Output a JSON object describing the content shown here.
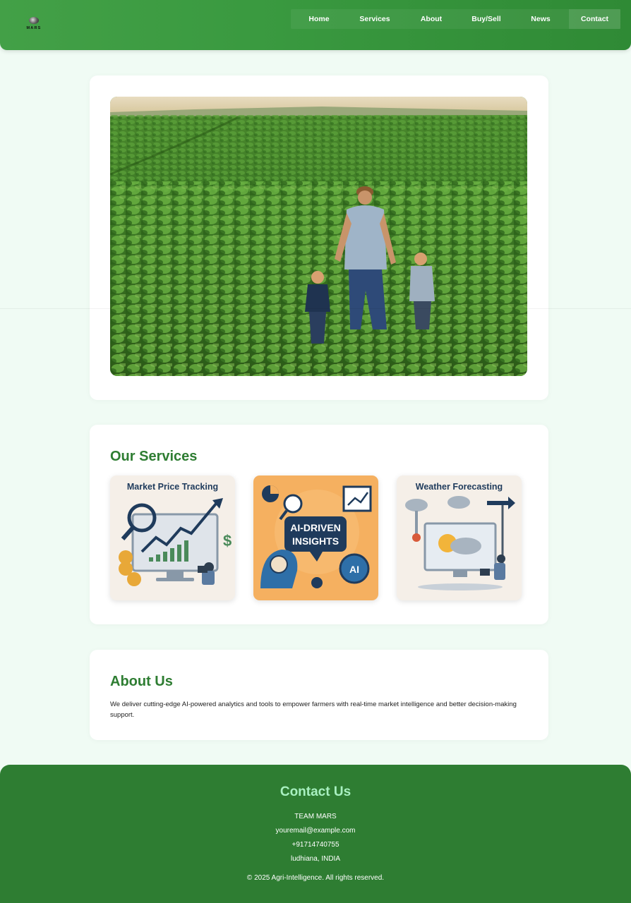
{
  "brand": {
    "logo_text": "MARS"
  },
  "nav": {
    "items": [
      {
        "label": "Home"
      },
      {
        "label": "Services"
      },
      {
        "label": "About"
      },
      {
        "label": "Buy/Sell"
      },
      {
        "label": "News"
      },
      {
        "label": "Contact"
      }
    ]
  },
  "services": {
    "title": "Our Services",
    "cards": [
      {
        "title": "Market Price Tracking"
      },
      {
        "title": "AI-DRIVEN INSIGHTS",
        "title_line1": "AI-DRIVEN",
        "title_line2": "INSIGHTS",
        "badge": "AI"
      },
      {
        "title": "Weather Forecasting"
      }
    ]
  },
  "about": {
    "title": "About Us",
    "text": "We deliver cutting-edge AI-powered analytics and tools to empower farmers with real-time market intelligence and better decision-making support."
  },
  "contact": {
    "title": "Contact Us",
    "team": "TEAM MARS",
    "email": "youremail@example.com",
    "phone": "+91714740755",
    "location": "ludhiana, INDIA",
    "copyright": "© 2025 Agri-Intelligence. All rights reserved."
  },
  "colors": {
    "header_green": "#43a047",
    "title_green": "#2e7d32",
    "footer_green": "#2e7d32",
    "footer_title": "#a8f0c0",
    "page_bg": "#f0fbf4"
  }
}
